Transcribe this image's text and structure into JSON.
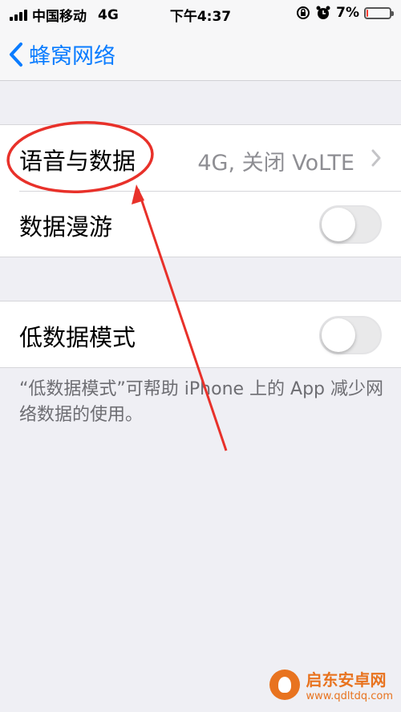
{
  "status_bar": {
    "carrier": "中国移动",
    "network": "4G",
    "time": "下午4:37",
    "battery_percent": "7%",
    "battery_level": 0.07
  },
  "nav": {
    "back_label": "蜂窝网络"
  },
  "group1": {
    "voice_data_label": "语音与数据",
    "voice_data_value": "4G, 关闭 VoLTE",
    "roaming_label": "数据漫游",
    "roaming_on": false
  },
  "group2": {
    "low_data_label": "低数据模式",
    "low_data_on": false
  },
  "footnote": "“低数据模式”可帮助 iPhone 上的 App 减少网络数据的使用。",
  "watermark": {
    "title": "启东安卓网",
    "url": "www.qdltdq.com"
  },
  "colors": {
    "accent": "#0a7cff",
    "annotation": "#e8312a"
  }
}
